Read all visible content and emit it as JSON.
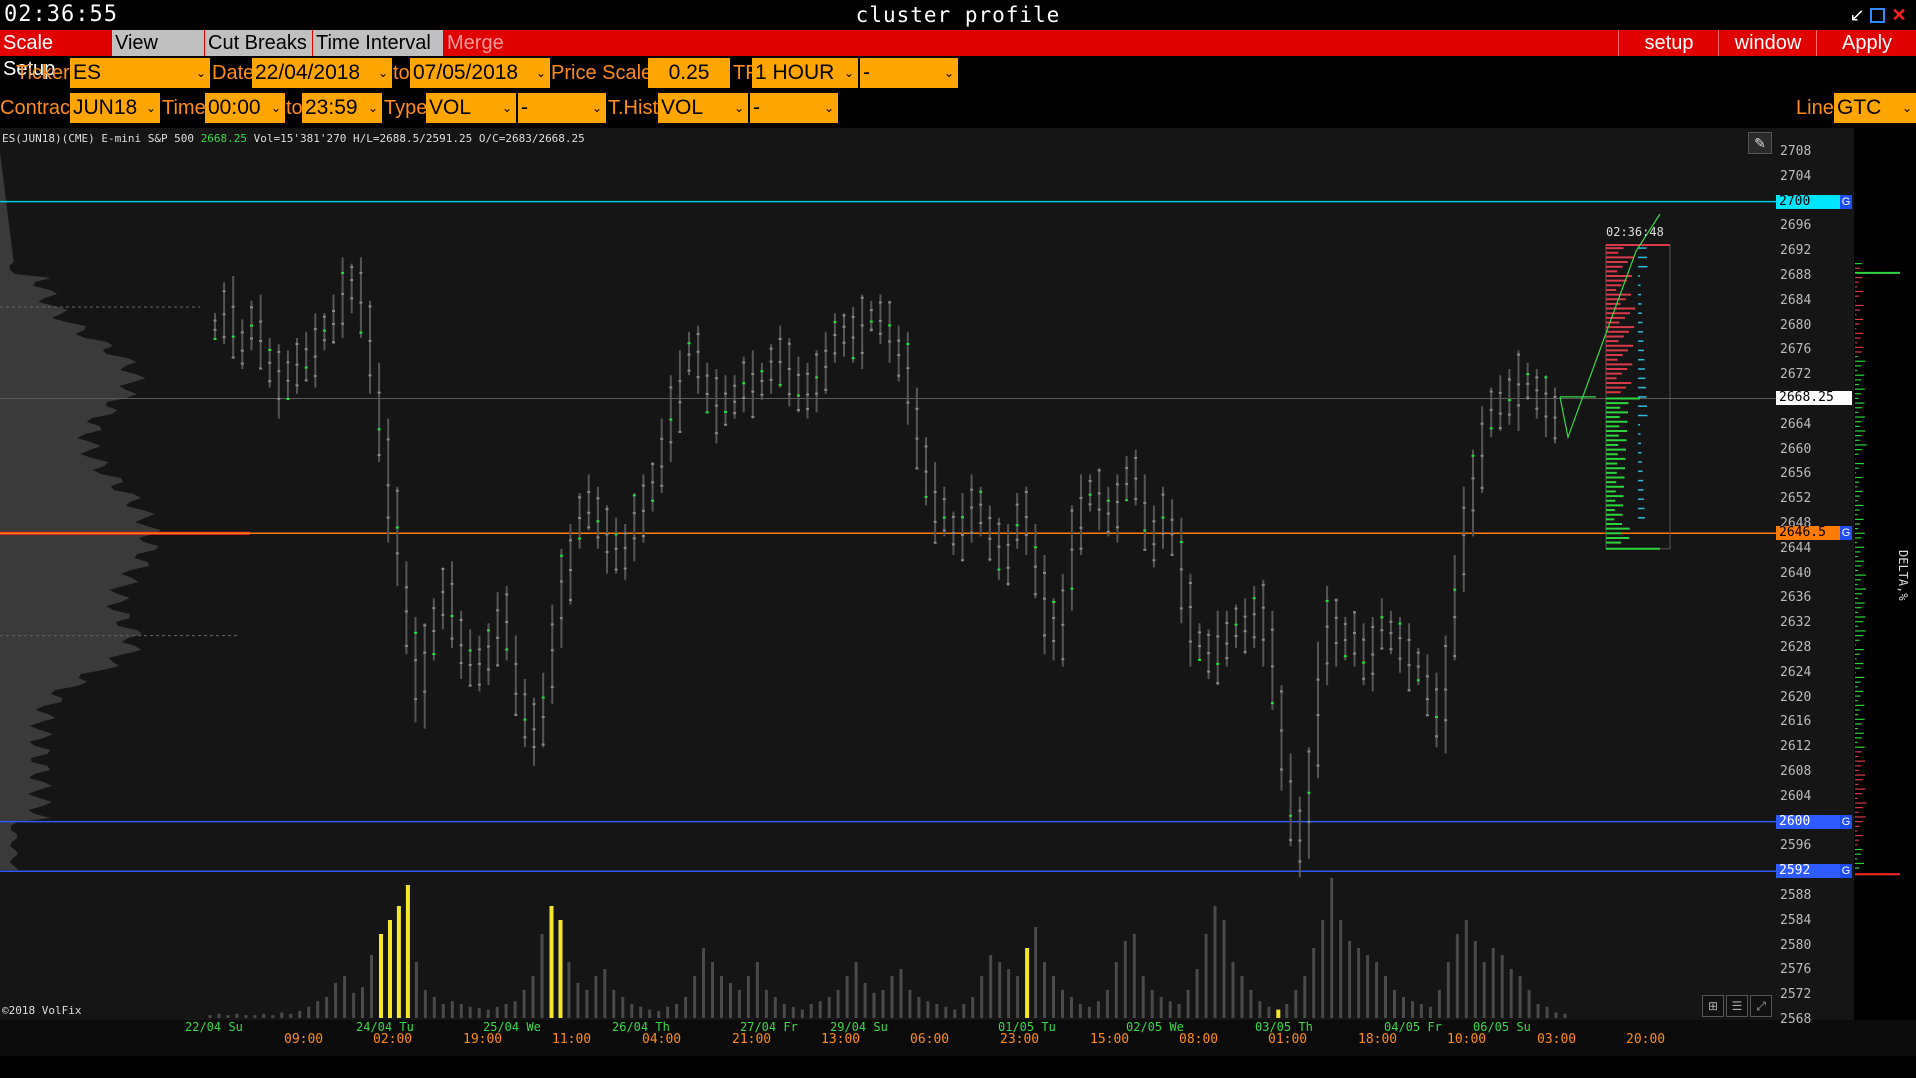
{
  "window": {
    "clock": "02:36:55",
    "title": "cluster profile"
  },
  "menu": {
    "tabs": [
      {
        "label": "Scale Setup",
        "bg": "#e00000",
        "fg": "#ffffff"
      },
      {
        "label": "View DOM",
        "bg": "#c0c0c0",
        "fg": "#000000"
      },
      {
        "label": "Cut Breaks",
        "bg": "#c0c0c0",
        "fg": "#000000"
      },
      {
        "label": "Time Interval",
        "bg": "#c0c0c0",
        "fg": "#000000"
      },
      {
        "label": "Merge Contr",
        "bg": "#e00000",
        "fg": "#ff9a9a"
      }
    ],
    "right": [
      "setup",
      "window",
      "Apply"
    ]
  },
  "toolbar1": {
    "ticker_label": "Ticker",
    "ticker": "ES",
    "date_label": "Date",
    "date_from": "22/04/2018",
    "to_label": "to",
    "date_to": "07/05/2018",
    "price_scale_label": "Price Scale",
    "price_scale": "0.25",
    "tf_label": "TF",
    "tf": "1 HOUR",
    "extra": "-"
  },
  "toolbar2": {
    "contract_label": "Contract",
    "contract": "JUN18",
    "time_label": "Time",
    "time_from": "00:00",
    "to_label": "to",
    "time_to": "23:59",
    "type_label": "Type",
    "type": "VOL",
    "type_extra": "-",
    "thist_label": "T.Hist",
    "thist": "VOL",
    "thist_extra": "-",
    "line_label": "Line",
    "line": "GTC"
  },
  "info": {
    "instrument": "ES(JUN18)(CME) E-mini S&P 500",
    "last": "2668.25",
    "stats": "Vol=15'381'270 H/L=2688.5/2591.25 O/C=2683/2668.25"
  },
  "copyright": "©2018 VolFix",
  "right_panel_label": "DELTA,%",
  "profile_time": "02:36:48",
  "price_tags": [
    {
      "price": 2700,
      "label": "2700",
      "color": "#00e5ff",
      "text": "#000000",
      "g": true
    },
    {
      "price": 2668.25,
      "label": "2668.25",
      "color": "#ffffff",
      "text": "#000000",
      "g": false
    },
    {
      "price": 2646.5,
      "label": "2646.5",
      "color": "#ff7a00",
      "text": "#000000",
      "g": true
    },
    {
      "price": 2600,
      "label": "2600",
      "color": "#2d5bff",
      "text": "#ffffff",
      "g": true
    },
    {
      "price": 2592,
      "label": "2592",
      "color": "#2d5bff",
      "text": "#ffffff",
      "g": true
    }
  ],
  "gtag_label": "G",
  "y_ticks": [
    "2708",
    "2704",
    "2700",
    "2696",
    "2692",
    "2688",
    "2684",
    "2680",
    "2676",
    "2672",
    "2668",
    "2664",
    "2660",
    "2656",
    "2652",
    "2648",
    "2644",
    "2640",
    "2636",
    "2632",
    "2628",
    "2624",
    "2620",
    "2616",
    "2612",
    "2608",
    "2604",
    "2600",
    "2596",
    "2592",
    "2588",
    "2584",
    "2580",
    "2576",
    "2572",
    "2568"
  ],
  "x_dates": [
    {
      "label": "22/04 Su",
      "x": 185
    },
    {
      "label": "24/04 Tu",
      "x": 356
    },
    {
      "label": "25/04 We",
      "x": 483
    },
    {
      "label": "26/04 Th",
      "x": 612
    },
    {
      "label": "27/04 Fr",
      "x": 740
    },
    {
      "label": "29/04 Su",
      "x": 830
    },
    {
      "label": "01/05 Tu",
      "x": 998
    },
    {
      "label": "02/05 We",
      "x": 1126
    },
    {
      "label": "03/05 Th",
      "x": 1255
    },
    {
      "label": "04/05 Fr",
      "x": 1384
    },
    {
      "label": "06/05 Su",
      "x": 1473
    }
  ],
  "x_times": [
    {
      "label": "09:00",
      "x": 284
    },
    {
      "label": "02:00",
      "x": 373
    },
    {
      "label": "19:00",
      "x": 463
    },
    {
      "label": "11:00",
      "x": 552
    },
    {
      "label": "04:00",
      "x": 642
    },
    {
      "label": "21:00",
      "x": 732
    },
    {
      "label": "13:00",
      "x": 821
    },
    {
      "label": "06:00",
      "x": 910
    },
    {
      "label": "23:00",
      "x": 1000
    },
    {
      "label": "15:00",
      "x": 1090
    },
    {
      "label": "08:00",
      "x": 1179
    },
    {
      "label": "01:00",
      "x": 1268
    },
    {
      "label": "18:00",
      "x": 1358
    },
    {
      "label": "10:00",
      "x": 1447
    },
    {
      "label": "03:00",
      "x": 1537
    },
    {
      "label": "20:00",
      "x": 1626
    }
  ],
  "price_path": [
    2680,
    2684,
    2679,
    2678,
    2681,
    2676,
    2674,
    2670,
    2672,
    2676,
    2675,
    2678,
    2680,
    2682,
    2687,
    2688,
    2680,
    2672,
    2662,
    2650,
    2640,
    2630,
    2620,
    2628,
    2634,
    2638,
    2632,
    2628,
    2624,
    2626,
    2630,
    2634,
    2628,
    2620,
    2616,
    2614,
    2622,
    2632,
    2640,
    2646,
    2650,
    2652,
    2648,
    2645,
    2642,
    2646,
    2650,
    2652,
    2656,
    2662,
    2668,
    2674,
    2676,
    2672,
    2670,
    2666,
    2668,
    2670,
    2672,
    2670,
    2672,
    2674,
    2676,
    2672,
    2668,
    2670,
    2674,
    2676,
    2678,
    2680,
    2678,
    2681,
    2682,
    2680,
    2678,
    2676,
    2666,
    2660,
    2655,
    2650,
    2648,
    2646,
    2650,
    2652,
    2648,
    2645,
    2643,
    2646,
    2650,
    2646,
    2640,
    2632,
    2628,
    2638,
    2648,
    2652,
    2654,
    2650,
    2650,
    2654,
    2656,
    2654,
    2648,
    2646,
    2650,
    2646,
    2636,
    2630,
    2628,
    2626,
    2630,
    2632,
    2630,
    2632,
    2636,
    2630,
    2620,
    2608,
    2600,
    2596,
    2610,
    2626,
    2634,
    2630,
    2628,
    2630,
    2626,
    2630,
    2632,
    2630,
    2628,
    2626,
    2624,
    2620,
    2616,
    2628,
    2640,
    2650,
    2658,
    2664,
    2666,
    2670,
    2668,
    2672,
    2670,
    2668,
    2666,
    2668
  ],
  "volume_bars": [
    2,
    3,
    2,
    3,
    2,
    2,
    3,
    2,
    4,
    3,
    5,
    8,
    12,
    15,
    25,
    30,
    18,
    22,
    45,
    60,
    70,
    80,
    95,
    40,
    20,
    15,
    10,
    12,
    10,
    8,
    7,
    6,
    8,
    10,
    12,
    20,
    30,
    60,
    80,
    70,
    40,
    25,
    20,
    30,
    35,
    20,
    15,
    10,
    8,
    6,
    5,
    8,
    10,
    15,
    30,
    50,
    40,
    30,
    25,
    20,
    30,
    40,
    20,
    15,
    10,
    8,
    6,
    10,
    12,
    15,
    20,
    30,
    40,
    25,
    18,
    20,
    30,
    35,
    20,
    15,
    12,
    10,
    8,
    6,
    10,
    15,
    30,
    45,
    40,
    35,
    30,
    50,
    65,
    40,
    30,
    20,
    15,
    10,
    8,
    12,
    20,
    40,
    55,
    60,
    30,
    20,
    15,
    12,
    10,
    20,
    35,
    60,
    80,
    70,
    40,
    30,
    20,
    12,
    8,
    6,
    10,
    20,
    30,
    50,
    70,
    100,
    70,
    55,
    50,
    45,
    40,
    30,
    20,
    15,
    12,
    10,
    8,
    20,
    40,
    60,
    70,
    55,
    40,
    50,
    45,
    35,
    30,
    20,
    10,
    8,
    4,
    3
  ],
  "spike_indices": [
    19,
    20,
    21,
    22,
    38,
    39,
    91,
    119
  ]
}
